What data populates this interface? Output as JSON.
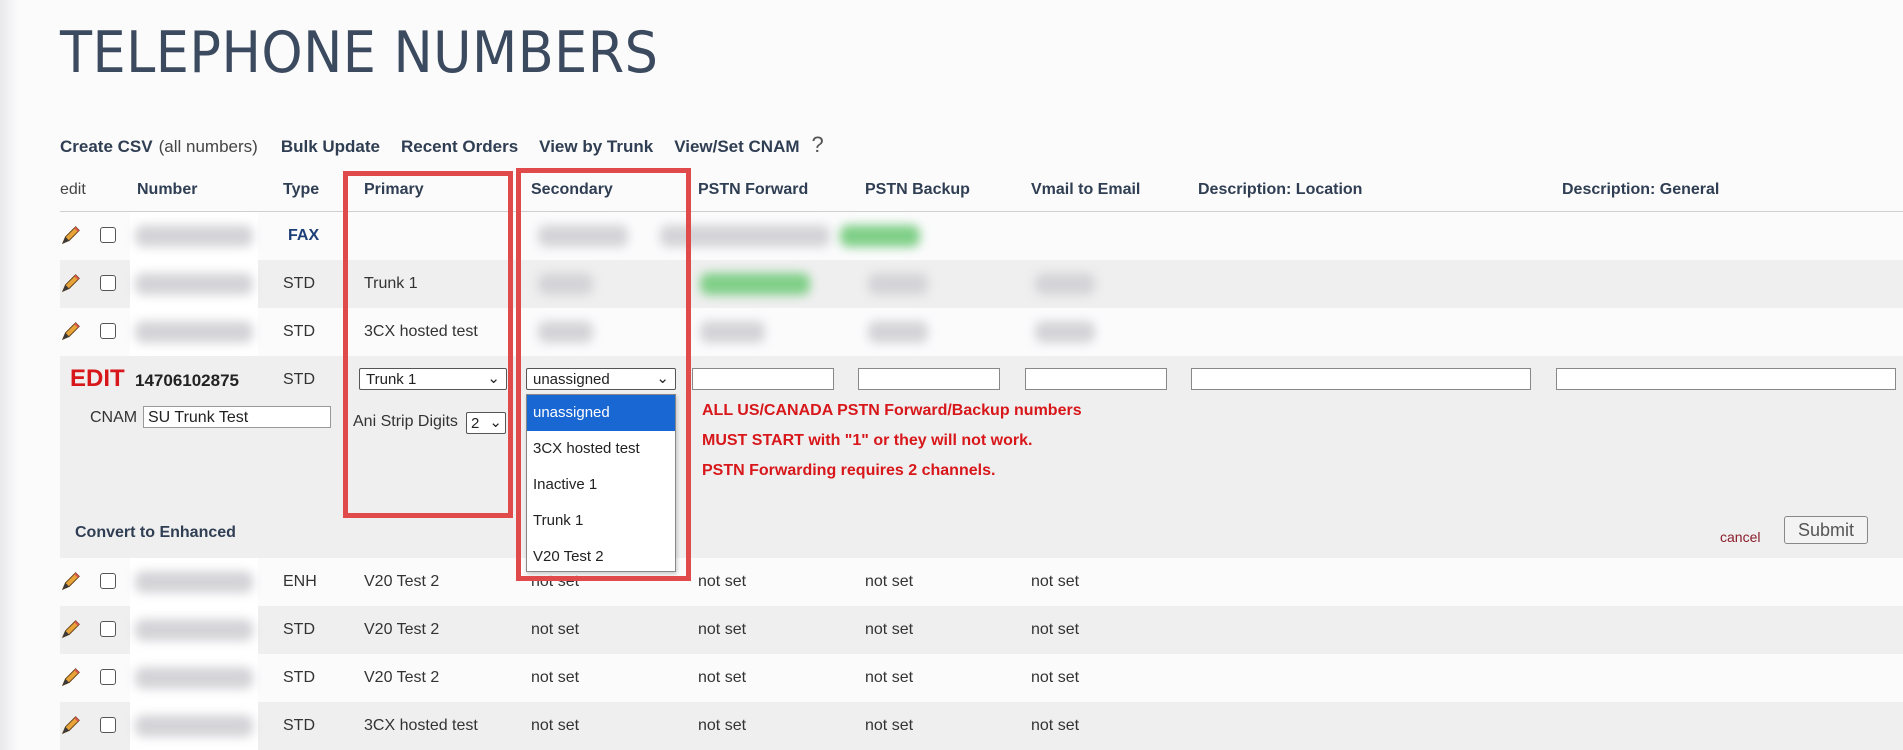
{
  "page": {
    "title": "TELEPHONE NUMBERS"
  },
  "toolbar": {
    "create_csv": "Create CSV",
    "create_csv_sub": "(all numbers)",
    "bulk_update": "Bulk Update",
    "recent_orders": "Recent Orders",
    "view_by_trunk": "View by Trunk",
    "view_set_cnam": "View/Set CNAM",
    "help": "?"
  },
  "columns": {
    "edit": "edit",
    "number": "Number",
    "type": "Type",
    "primary": "Primary",
    "secondary": "Secondary",
    "pstn_forward": "PSTN Forward",
    "pstn_backup": "PSTN Backup",
    "vmail_email": "Vmail to Email",
    "desc_location": "Description: Location",
    "desc_general": "Description: General"
  },
  "rows_top": [
    {
      "type": "FAX",
      "primary": ""
    },
    {
      "type": "STD",
      "primary": "Trunk 1"
    },
    {
      "type": "STD",
      "primary": "3CX hosted test"
    }
  ],
  "edit_row": {
    "label": "EDIT",
    "number": "14706102875",
    "type": "STD",
    "primary_value": "Trunk 1",
    "secondary_value": "unassigned",
    "cnam_label": "CNAM",
    "cnam_value": "SU Trunk Test",
    "ani_label": "Ani Strip Digits",
    "ani_value": "2",
    "notice_1": "ALL US/CANADA PSTN Forward/Backup numbers",
    "notice_2": "MUST START with \"1\" or they will not work.",
    "notice_3": "PSTN Forwarding requires 2 channels.",
    "convert": "Convert to Enhanced",
    "cancel": "cancel",
    "submit": "Submit"
  },
  "dropdown_options": [
    "unassigned",
    "3CX hosted test",
    "Inactive 1",
    "Trunk 1",
    "V20 Test 2"
  ],
  "rows_bottom": [
    {
      "type": "ENH",
      "primary": "V20 Test 2",
      "secondary": "not set",
      "pstn_forward": "not set",
      "pstn_backup": "not set",
      "vmail": "not set"
    },
    {
      "type": "STD",
      "primary": "V20 Test 2",
      "secondary": "not set",
      "pstn_forward": "not set",
      "pstn_backup": "not set",
      "vmail": "not set"
    },
    {
      "type": "STD",
      "primary": "V20 Test 2",
      "secondary": "not set",
      "pstn_forward": "not set",
      "pstn_backup": "not set",
      "vmail": "not set"
    },
    {
      "type": "STD",
      "primary": "3CX hosted test",
      "secondary": "not set",
      "pstn_forward": "not set",
      "pstn_backup": "not set",
      "vmail": "not set"
    }
  ],
  "colors": {
    "accent_red": "#d8171b",
    "highlight_red": "#e04a4a",
    "link_dark": "#2f3e52",
    "dropdown_selected": "#1967d2"
  }
}
